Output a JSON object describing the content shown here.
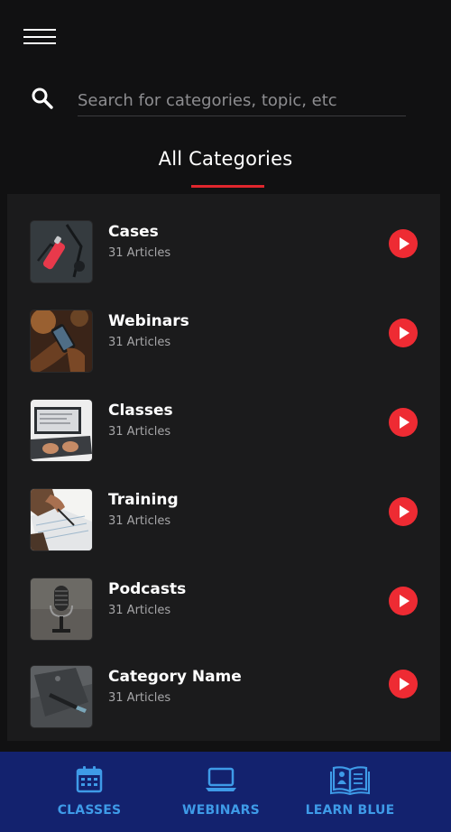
{
  "search": {
    "placeholder": "Search for categories, topic, etc"
  },
  "header": {
    "title": "All Categories"
  },
  "categories": [
    {
      "title": "Cases",
      "subtitle": "31 Articles",
      "thumb": "cases-thumbnail"
    },
    {
      "title": "Webinars",
      "subtitle": "31 Articles",
      "thumb": "webinars-thumbnail"
    },
    {
      "title": "Classes",
      "subtitle": "31 Articles",
      "thumb": "classes-thumbnail"
    },
    {
      "title": "Training",
      "subtitle": "31 Articles",
      "thumb": "training-thumbnail"
    },
    {
      "title": "Podcasts",
      "subtitle": "31 Articles",
      "thumb": "podcasts-thumbnail"
    },
    {
      "title": "Category Name",
      "subtitle": "31 Articles",
      "thumb": "category-thumbnail"
    }
  ],
  "bottom_nav": [
    {
      "label": "CLASSES",
      "icon": "calendar-icon"
    },
    {
      "label": "WEBINARS",
      "icon": "laptop-icon"
    },
    {
      "label": "LEARN BLUE",
      "icon": "book-icon"
    }
  ],
  "colors": {
    "background": "#111112",
    "panel": "#1b1b1c",
    "accent_red": "#ee2b33",
    "nav_background": "#13226e",
    "nav_text": "#3e9be8"
  }
}
